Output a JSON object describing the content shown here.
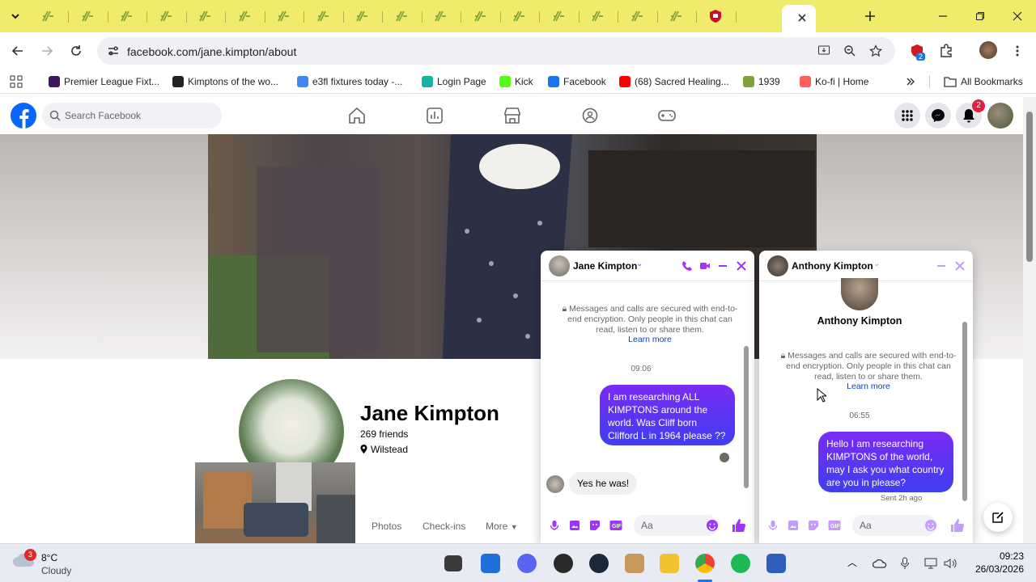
{
  "browser": {
    "tabs_group_label": "",
    "url": "facebook.com/jane.kimpton/about",
    "extension_badge": "2",
    "bookmarks": [
      {
        "label": "Premier League Fixt...",
        "color": "#3d195b"
      },
      {
        "label": "Kimptons of the wo...",
        "color": "#222222"
      },
      {
        "label": "e3fl fixtures today -...",
        "color": "#4285f4"
      },
      {
        "label": "Login Page",
        "color": "#19b3a3"
      },
      {
        "label": "Kick",
        "color": "#53fc18"
      },
      {
        "label": "Facebook",
        "color": "#1877f2"
      },
      {
        "label": "(68) Sacred Healing...",
        "color": "#ff0000"
      },
      {
        "label": "1939",
        "color": "#7fa33a"
      },
      {
        "label": "Ko-fi | Home",
        "color": "#ff5e5b"
      }
    ],
    "all_bookmarks": "All Bookmarks"
  },
  "facebook": {
    "search_placeholder": "Search Facebook",
    "notifications_count": "2",
    "profile": {
      "name": "Jane Kimpton",
      "friends": "269 friends",
      "location": "Wilstead"
    },
    "profile_tabs": [
      "Photos",
      "Check-ins",
      "More"
    ]
  },
  "chats": [
    {
      "name": "Jane Kimpton",
      "secure_text": "Messages and calls are secured with end-to-end encryption. Only people in this chat can read, listen to or share them.",
      "learn_more": "Learn more",
      "time": "09:06",
      "outgoing": "I am researching ALL KIMPTONS around the world.  Was Cliff born Clifford L in 1964 please ??",
      "incoming": "Yes he was!",
      "input_placeholder": "Aa"
    },
    {
      "name": "Anthony Kimpton",
      "header_name": "Anthony Kimpton",
      "secure_text": "Messages and calls are secured with end-to-end encryption. Only people in this chat can read, listen to or share them.",
      "learn_more": "Learn more",
      "time": "06:55",
      "outgoing": "Hello I am researching KIMPTONS of the world, may I ask you what country are you in please?",
      "sent_status": "Sent 2h ago",
      "input_placeholder": "Aa"
    }
  ],
  "taskbar": {
    "weather_badge": "3",
    "temperature": "8°C",
    "condition": "Cloudy",
    "clock_time": "09:23",
    "clock_date": "26/03/2026"
  },
  "colors": {
    "tab_strip": "#f1eb6b",
    "fb_blue": "#0866ff",
    "messenger_purple": "#a033ff"
  }
}
